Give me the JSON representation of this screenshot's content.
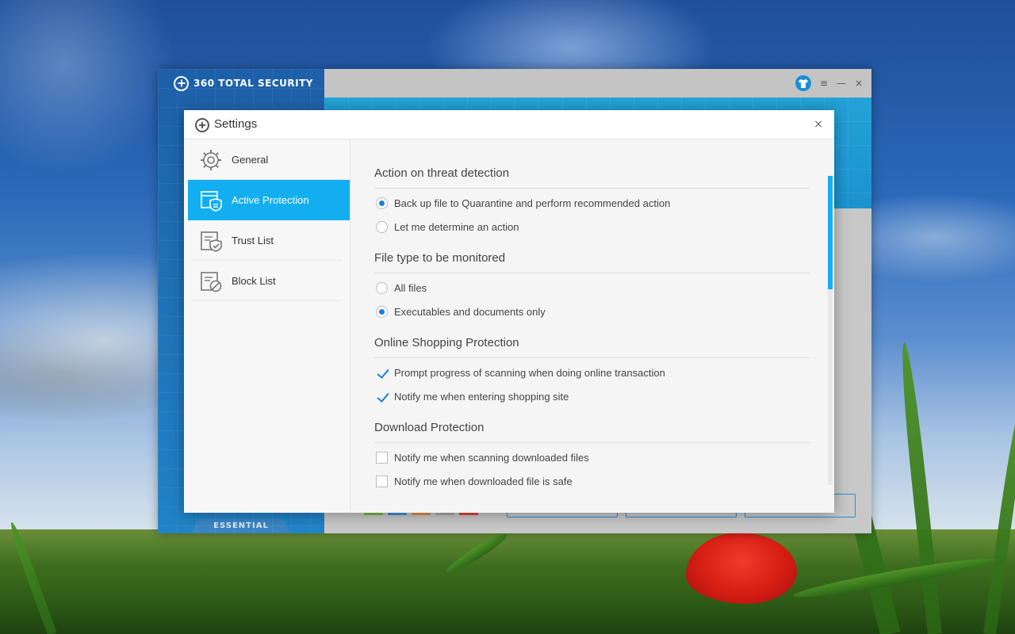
{
  "app": {
    "brand": "360 TOTAL SECURITY",
    "edition": "ESSENTIAL",
    "skin_icon": "shirt-icon",
    "menu_icon": "≡",
    "minimize_icon": "—",
    "close_icon": "×"
  },
  "dialog": {
    "title": "Settings",
    "close_icon": "×"
  },
  "nav": {
    "items": [
      {
        "label": "General",
        "icon": "gear-icon",
        "active": false
      },
      {
        "label": "Active Protection",
        "icon": "shield-window-icon",
        "active": true
      },
      {
        "label": "Trust List",
        "icon": "trust-list-icon",
        "active": false
      },
      {
        "label": "Block List",
        "icon": "block-list-icon",
        "active": false
      }
    ]
  },
  "content": {
    "sections": [
      {
        "title": "Action on threat detection",
        "control": "radio",
        "options": [
          {
            "label": "Back up file to Quarantine and perform recommended action",
            "checked": true
          },
          {
            "label": "Let me determine an action",
            "checked": false
          }
        ]
      },
      {
        "title": "File type to be monitored",
        "control": "radio",
        "options": [
          {
            "label": "All files",
            "checked": false
          },
          {
            "label": "Executables and documents only",
            "checked": true
          }
        ]
      },
      {
        "title": "Online Shopping Protection",
        "control": "checkbox",
        "options": [
          {
            "label": "Prompt progress of scanning when doing online transaction",
            "checked": true
          },
          {
            "label": "Notify me when entering shopping site",
            "checked": true
          }
        ]
      },
      {
        "title": "Download Protection",
        "control": "checkbox",
        "options": [
          {
            "label": "Notify me when scanning downloaded files",
            "checked": false
          },
          {
            "label": "Notify me when downloaded file is safe",
            "checked": false
          }
        ]
      }
    ]
  },
  "colors": {
    "accent": "#13aef0",
    "check": "#1e7fd8"
  }
}
